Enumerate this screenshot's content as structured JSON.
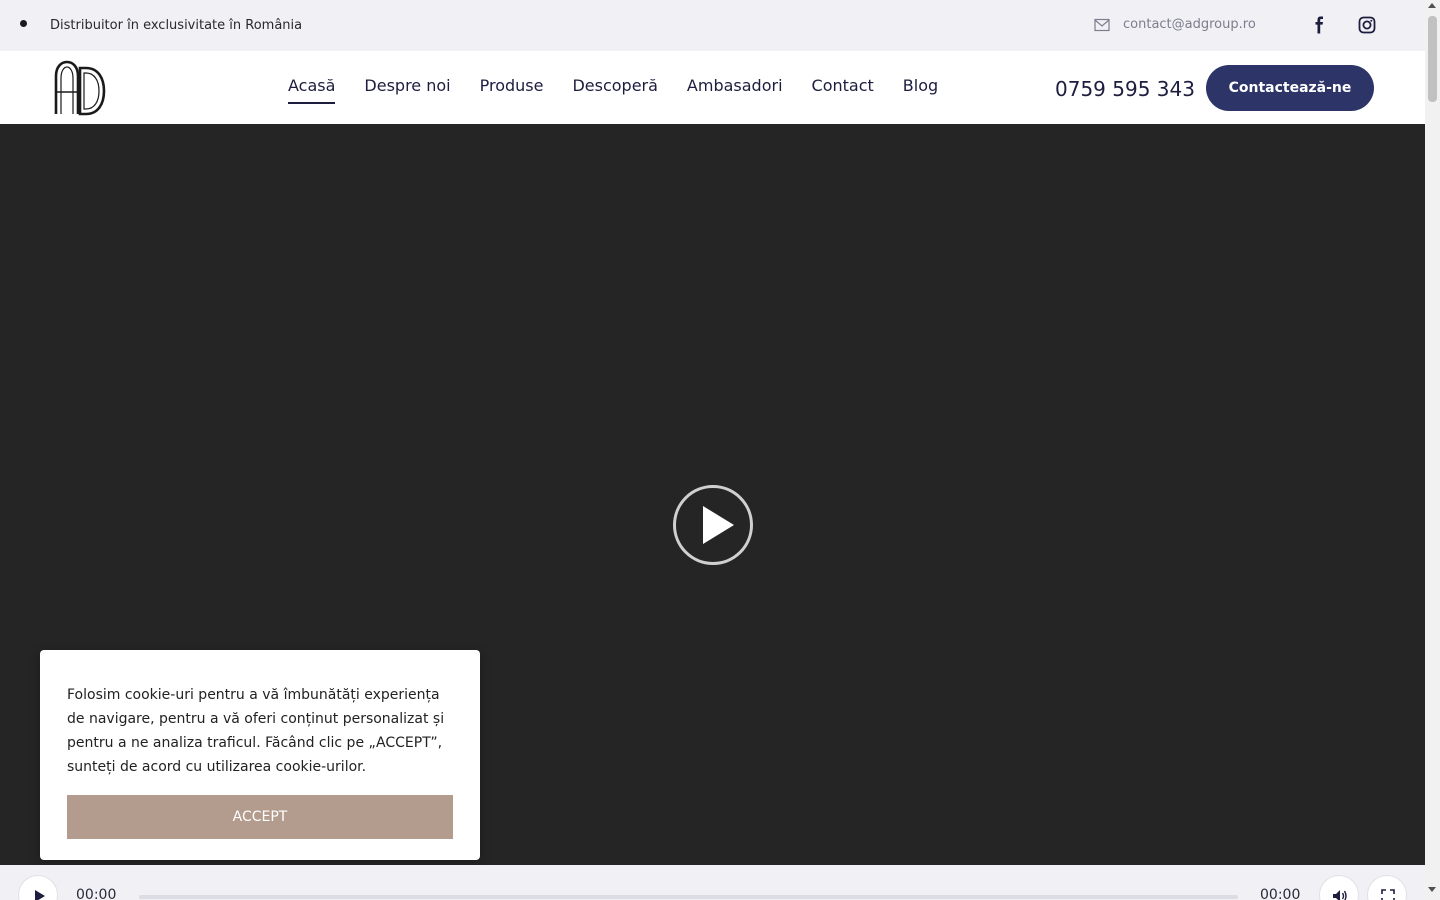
{
  "topbar": {
    "tagline": "Distribuitor în exclusivitate în România",
    "email": "contact@adgroup.ro",
    "icons": [
      "mail-icon",
      "facebook-icon",
      "instagram-icon"
    ]
  },
  "header": {
    "logo_text": "AD",
    "nav": [
      {
        "label": "Acasă",
        "active": true
      },
      {
        "label": "Despre noi",
        "active": false
      },
      {
        "label": "Produse",
        "active": false
      },
      {
        "label": "Descoperă",
        "active": false
      },
      {
        "label": "Ambasadori",
        "active": false
      },
      {
        "label": "Contact",
        "active": false
      },
      {
        "label": "Blog",
        "active": false
      }
    ],
    "phone": "0759 595 343",
    "cta_label": "Contactează-ne"
  },
  "video": {
    "current_time": "00:00",
    "total_time": "00:00",
    "progress": 0
  },
  "cookie": {
    "text": "Folosim cookie-uri pentru a vă îmbunătăți experiența de navigare, pentru a vă oferi conținut personalizat și pentru a ne analiza traficul. Făcând clic pe „ACCEPT”, sunteți de acord cu utilizarea cookie-urilor.",
    "accept_label": "ACCEPT"
  },
  "colors": {
    "brand": "#2c3468",
    "accept": "#b39c8d",
    "hero_bg": "#252525",
    "topbar_bg": "#f0f0f5"
  }
}
